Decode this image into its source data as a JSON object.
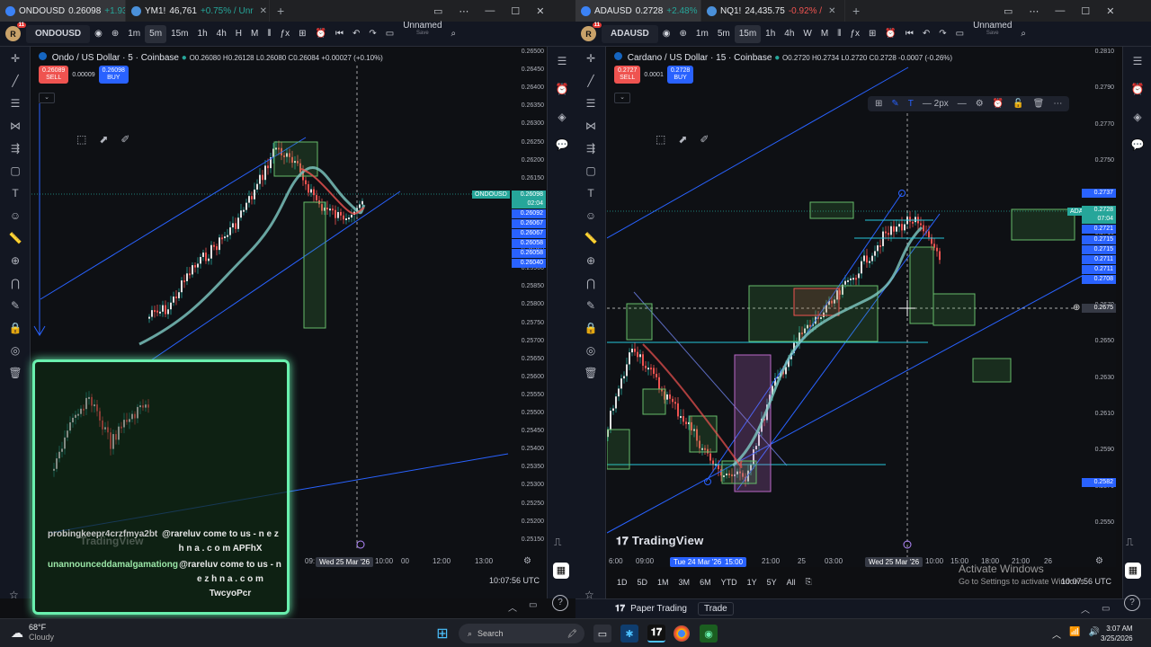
{
  "left": {
    "tabs": [
      {
        "symbol": "ONDOUSD",
        "price": "0.26098",
        "change": "+1.93",
        "dir": "pos",
        "fav": "#3b82f6",
        "active": true
      },
      {
        "symbol": "YM1!",
        "price": "46,761",
        "change": "+0.75% / Unr",
        "dir": "pos",
        "fav": "#4a90d9",
        "active": false
      }
    ],
    "toolbar": {
      "symbol": "ONDOUSD",
      "intervals": [
        "1m",
        "5m",
        "15m",
        "1h",
        "4h",
        "H",
        "M"
      ],
      "active_interval": "5m",
      "layout_name": "Unnamed",
      "layout_sub": "Save"
    },
    "legend": {
      "title": "Ondo / US Dollar · 5 · Coinbase",
      "ohlc": "O0.26080 H0.26128 L0.26080 C0.26084 +0.00027 (+0.10%)"
    },
    "sell": {
      "price": "0.26089",
      "label": "SELL"
    },
    "buy": {
      "price": "0.26098",
      "label": "BUY"
    },
    "spread": "0.00009",
    "price_labels": [
      "0.26500",
      "0.26450",
      "0.26400",
      "0.26350",
      "0.26300",
      "0.26250",
      "0.26200",
      "0.26150",
      "0.26100",
      "0.26050",
      "0.26000",
      "0.25950",
      "0.25900",
      "0.25850",
      "0.25800",
      "0.25750",
      "0.25700",
      "0.25650",
      "0.25600",
      "0.25550",
      "0.25500",
      "0.25450",
      "0.25400",
      "0.25350",
      "0.25300",
      "0.25250",
      "0.25200",
      "0.25150"
    ],
    "price_tags": [
      {
        "text": "0.26098",
        "bg": "#26a69a"
      },
      {
        "text": "02:04",
        "bg": "#26a69a"
      },
      {
        "text": "0.26092",
        "bg": "#2962ff"
      },
      {
        "text": "0.26067",
        "bg": "#2962ff"
      },
      {
        "text": "0.26067",
        "bg": "#2962ff"
      },
      {
        "text": "0.26058",
        "bg": "#2962ff"
      },
      {
        "text": "0.26058",
        "bg": "#2962ff"
      },
      {
        "text": "0.26040",
        "bg": "#2962ff"
      }
    ],
    "symbol_tag": "ONDOUSD",
    "time_labels": [
      "09:",
      "Wed 25 Mar '26",
      "10:00",
      "00",
      "12:00",
      "13:00"
    ],
    "clock": "10:07:56 UTC"
  },
  "overlay": {
    "chat": [
      {
        "user": "probingkeepr4crzfmya2bt",
        "text": "@rareluv come to us - n e z h n a . c o m APFhX"
      },
      {
        "user": "unannounceddamalgamationg",
        "text": "@rareluv come to us - n e z h n a . c o m TwcyoPcr"
      }
    ],
    "ghost": "TradingView"
  },
  "right": {
    "tabs": [
      {
        "symbol": "ADAUSD",
        "price": "0.2728",
        "change": "+2.48%",
        "dir": "pos",
        "fav": "#3b82f6",
        "active": true
      },
      {
        "symbol": "NQ1!",
        "price": "24,435.75",
        "change": "-0.92% /",
        "dir": "neg",
        "fav": "#4a90d9",
        "active": false
      }
    ],
    "toolbar": {
      "symbol": "ADAUSD",
      "intervals": [
        "1m",
        "5m",
        "15m",
        "1h",
        "4h",
        "W",
        "M"
      ],
      "active_interval": "15m",
      "layout_name": "Unnamed",
      "layout_sub": "Save"
    },
    "legend": {
      "title": "Cardano / US Dollar · 15 · Coinbase",
      "ohlc": "O0.2720 H0.2734 L0.2720 C0.2728 -0.0007 (-0.26%)"
    },
    "sell": {
      "price": "0.2727",
      "label": "SELL"
    },
    "buy": {
      "price": "0.2728",
      "label": "BUY"
    },
    "spread": "0.0001",
    "drawbar": {
      "stroke": "2px"
    },
    "price_labels": [
      "0.2810",
      "0.2790",
      "0.2770",
      "0.2750",
      "0.2730",
      "0.2710",
      "0.2690",
      "0.2670",
      "0.2650",
      "0.2630",
      "0.2610",
      "0.2590",
      "0.2570",
      "0.2550"
    ],
    "price_tags": [
      {
        "text": "0.2737",
        "bg": "#2962ff"
      },
      {
        "text": "0.2728",
        "bg": "#26a69a"
      },
      {
        "text": "07:04",
        "bg": "#26a69a"
      },
      {
        "text": "0.2721",
        "bg": "#2962ff"
      },
      {
        "text": "0.2715",
        "bg": "#2962ff"
      },
      {
        "text": "0.2715",
        "bg": "#2962ff"
      },
      {
        "text": "0.2711",
        "bg": "#2962ff"
      },
      {
        "text": "0.2711",
        "bg": "#2962ff"
      },
      {
        "text": "0.2708",
        "bg": "#2962ff"
      },
      {
        "text": "0.2675",
        "bg": "#363a45"
      },
      {
        "text": "0.2582",
        "bg": "#2962ff"
      }
    ],
    "symbol_tag": "ADAUSD",
    "time_labels": [
      "6:00",
      "09:00",
      "Tue 24 Mar '26",
      "15:00",
      "21:00",
      "25",
      "03:00",
      "Wed 25 Mar '26",
      "10:00",
      "15:00",
      "18:00",
      "21:00",
      "26"
    ],
    "periods": [
      "1D",
      "5D",
      "1M",
      "3M",
      "6M",
      "YTD",
      "1Y",
      "5Y",
      "All"
    ],
    "clock": "10:07:56 UTC",
    "paper": "Paper Trading",
    "trade": "Trade",
    "tv": "TradingView",
    "activate_title": "Activate Windows",
    "activate_sub": "Go to Settings to activate Windows."
  },
  "taskbar": {
    "temp": "68°F",
    "weather": "Cloudy",
    "search": "Search",
    "time": "3:07 AM",
    "date": "3/25/2026"
  }
}
